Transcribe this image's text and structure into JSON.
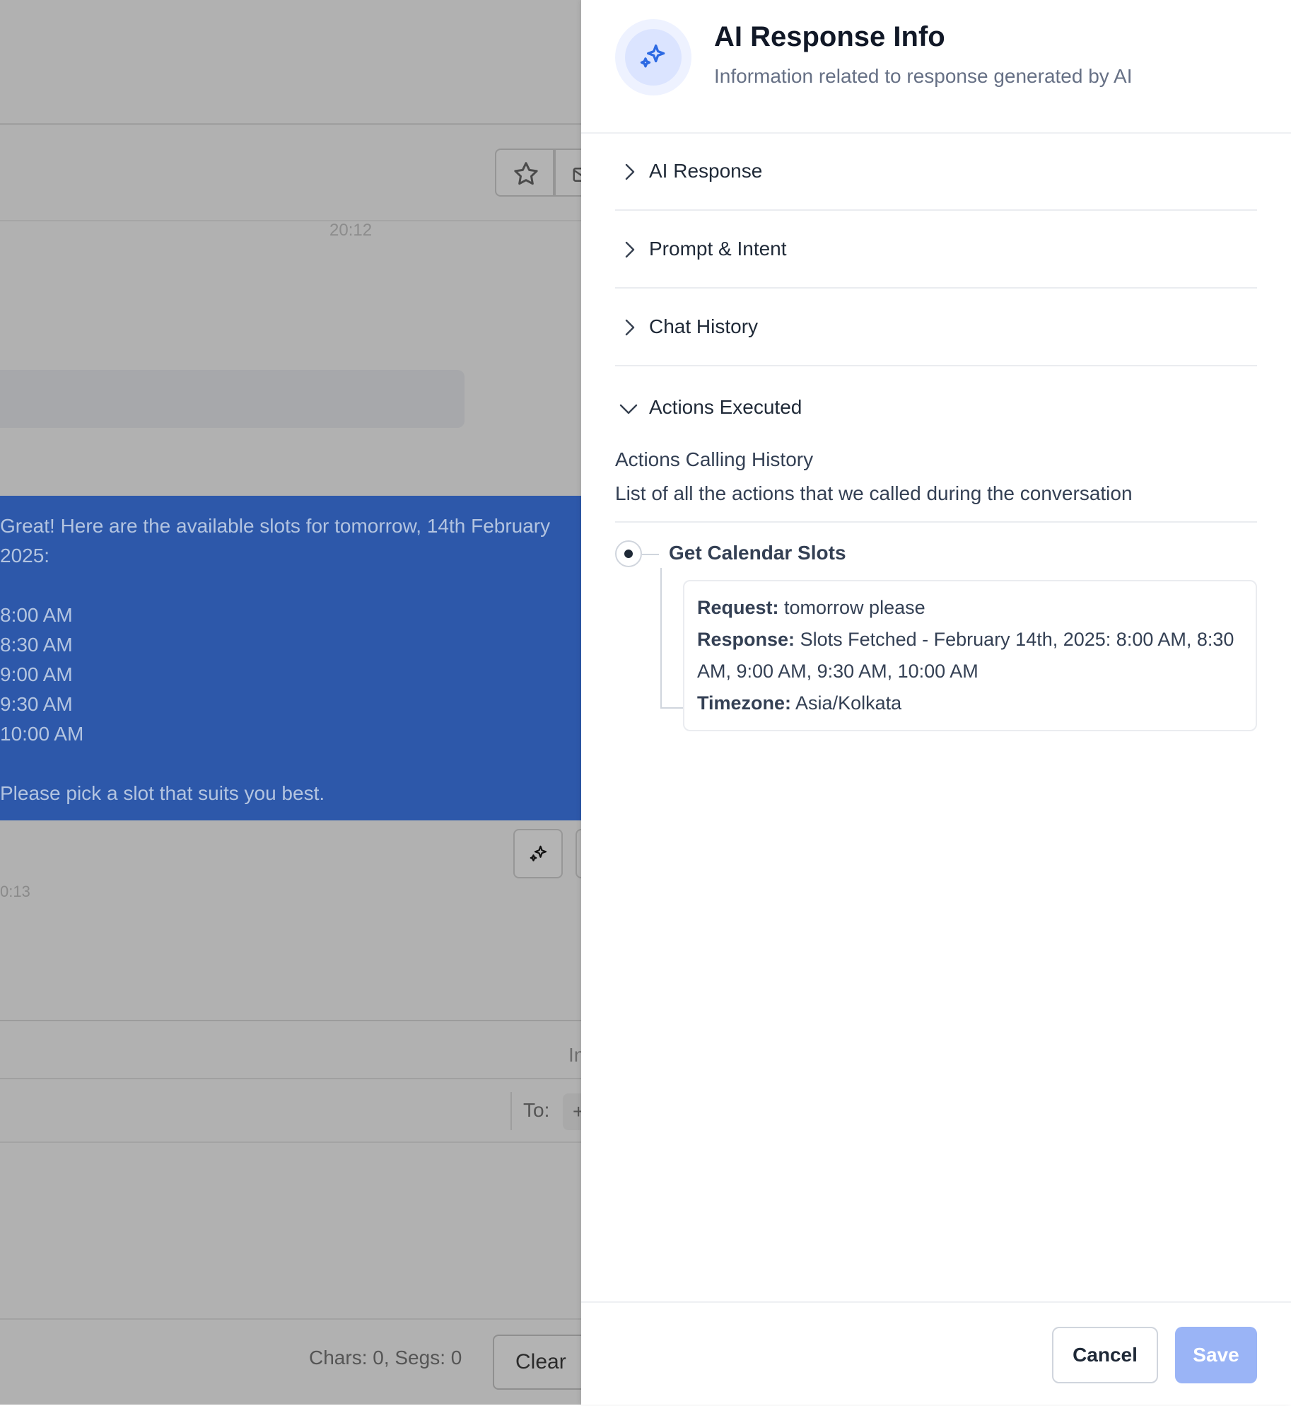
{
  "background": {
    "timestamp_top": "20:12",
    "ai_message_lines": [
      "Great! Here are the available slots for tomorrow, 14th February",
      "2025:",
      "",
      "8:00 AM",
      "8:30 AM",
      "9:00 AM",
      "9:30 AM",
      "10:00 AM",
      "",
      "Please pick a slot that suits you best."
    ],
    "timestamp_bottom": "0:13",
    "tab_partial": "In",
    "to_label": "To:",
    "to_chip": "+",
    "counts": "Chars: 0, Segs: 0",
    "clear_label": "Clear"
  },
  "drawer": {
    "title": "AI Response Info",
    "subtitle": "Information related to response generated by AI",
    "sections": [
      {
        "label": "AI Response"
      },
      {
        "label": "Prompt & Intent"
      },
      {
        "label": "Chat History"
      },
      {
        "label": "Actions Executed"
      }
    ],
    "actions": {
      "title": "Actions Calling History",
      "description": "List of all the actions that we called during the conversation",
      "items": [
        {
          "name": "Get Calendar Slots",
          "request_label": "Request:",
          "request_value": "tomorrow please",
          "response_label": "Response:",
          "response_value_line1": "Slots Fetched - February 14th, 2025: 8:00 AM, 8:30",
          "response_value_line2": "AM, 9:00 AM, 9:30 AM, 10:00 AM",
          "timezone_label": "Timezone:",
          "timezone_value": "Asia/Kolkata"
        }
      ]
    },
    "footer": {
      "cancel_label": "Cancel",
      "save_label": "Save"
    }
  },
  "colors": {
    "accent": "#2d6ae3",
    "save_disabled": "#9ab4f6",
    "overlay": "#b1b1b1",
    "message_bubble": "#2d58aa"
  },
  "icons": {
    "header": "sparkles-icon",
    "star": "star-icon",
    "envelope": "envelope-icon",
    "ai": "sparkles-icon",
    "collapsed": "chevron-right-icon",
    "expanded": "chevron-down-icon"
  }
}
